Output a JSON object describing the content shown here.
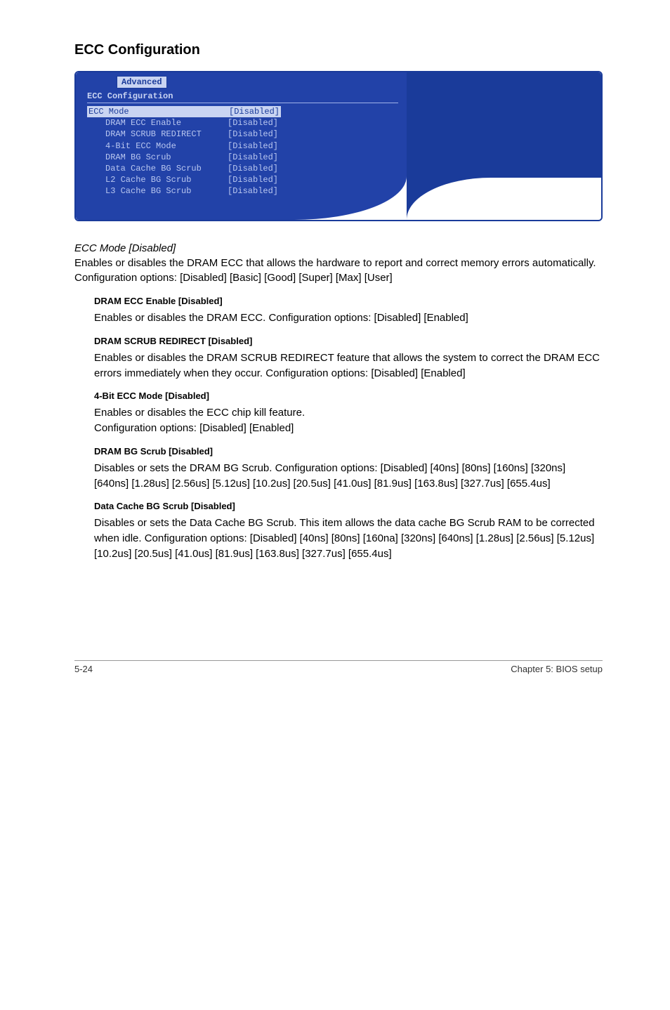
{
  "section_title": "ECC Configuration",
  "bios": {
    "tab": "Advanced",
    "panel_title": "ECC Configuration",
    "rows": [
      {
        "label": "ECC Mode",
        "value": "[Disabled]",
        "selected": true,
        "indent": false
      },
      {
        "label": "DRAM ECC Enable",
        "value": "[Disabled]",
        "selected": false,
        "indent": true
      },
      {
        "label": "DRAM SCRUB REDIRECT",
        "value": "[Disabled]",
        "selected": false,
        "indent": true
      },
      {
        "label": "4-Bit ECC Mode",
        "value": "[Disabled]",
        "selected": false,
        "indent": true
      },
      {
        "label": "DRAM BG Scrub",
        "value": "[Disabled]",
        "selected": false,
        "indent": true
      },
      {
        "label": "Data Cache BG Scrub",
        "value": "[Disabled]",
        "selected": false,
        "indent": true
      },
      {
        "label": "L2 Cache BG Scrub",
        "value": "[Disabled]",
        "selected": false,
        "indent": true
      },
      {
        "label": "L3 Cache BG Scrub",
        "value": "[Disabled]",
        "selected": false,
        "indent": true
      }
    ]
  },
  "ecc_mode": {
    "title": "ECC Mode [Disabled]",
    "body": "Enables or disables the DRAM ECC that allows the hardware to report and correct memory errors automatically. Configuration options: [Disabled] [Basic] [Good] [Super] [Max] [User]"
  },
  "subs": [
    {
      "head": "DRAM ECC Enable [Disabled]",
      "body": "Enables or disables the DRAM ECC. Configuration options: [Disabled] [Enabled]"
    },
    {
      "head": "DRAM SCRUB REDIRECT [Disabled]",
      "body": "Enables or disables the DRAM SCRUB REDIRECT feature that allows the system to correct the DRAM ECC errors immediately when they occur. Configuration options: [Disabled] [Enabled]"
    },
    {
      "head": "4-Bit ECC Mode [Disabled]",
      "body": "Enables or disables the ECC chip kill feature.\nConfiguration options: [Disabled] [Enabled]"
    },
    {
      "head": "DRAM BG Scrub [Disabled]",
      "body": "Disables or sets the DRAM BG Scrub. Configuration options: [Disabled] [40ns] [80ns] [160ns] [320ns] [640ns] [1.28us] [2.56us] [5.12us] [10.2us] [20.5us] [41.0us] [81.9us] [163.8us] [327.7us] [655.4us]"
    },
    {
      "head": "Data Cache BG Scrub [Disabled]",
      "body": "Disables or sets the Data Cache BG Scrub. This item allows the data cache BG Scrub RAM to be corrected when idle. Configuration options: [Disabled] [40ns] [80ns] [160na] [320ns] [640ns] [1.28us] [2.56us] [5.12us] [10.2us] [20.5us] [41.0us] [81.9us] [163.8us] [327.7us] [655.4us]"
    }
  ],
  "footer": {
    "left": "5-24",
    "right": "Chapter 5: BIOS setup"
  }
}
